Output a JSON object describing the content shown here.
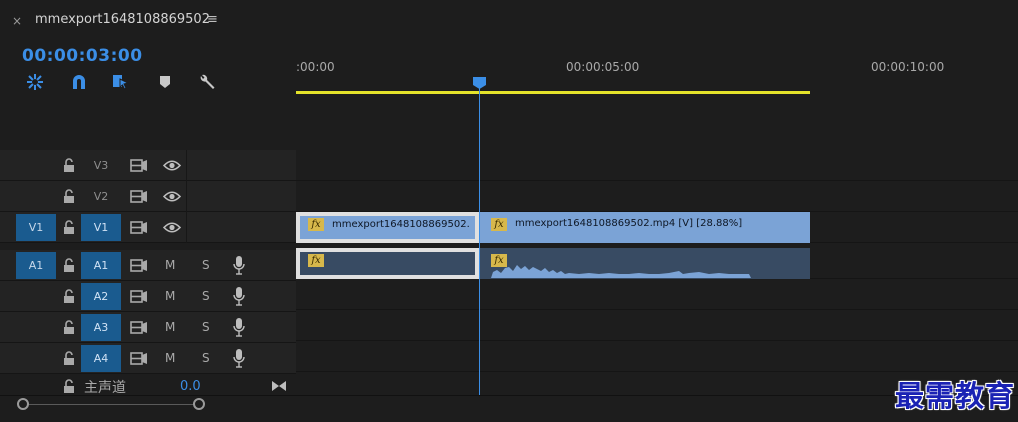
{
  "panel": {
    "close_glyph": "×",
    "sequence_title": "mmexport1648108869502",
    "menu_glyph": "≡",
    "timecode": "00:00:03:00"
  },
  "toolbar": {
    "icons": [
      "nest-sequence-icon",
      "snap-magnet-icon",
      "linked-selection-icon",
      "add-marker-icon",
      "timeline-settings-wrench-icon"
    ]
  },
  "ruler": {
    "labels": [
      ":00:00",
      "00:00:05:00",
      "00:00:10:00"
    ]
  },
  "tracks": {
    "video": [
      {
        "source": "",
        "name": "V3",
        "targeted": false
      },
      {
        "source": "",
        "name": "V2",
        "targeted": false
      },
      {
        "source": "V1",
        "name": "V1",
        "targeted": true
      }
    ],
    "audio": [
      {
        "source": "A1",
        "name": "A1",
        "targeted": true,
        "mute": "M",
        "solo": "S"
      },
      {
        "source": "",
        "name": "A2",
        "targeted": true,
        "mute": "M",
        "solo": "S"
      },
      {
        "source": "",
        "name": "A3",
        "targeted": true,
        "mute": "M",
        "solo": "S"
      },
      {
        "source": "",
        "name": "A4",
        "targeted": true,
        "mute": "M",
        "solo": "S"
      }
    ],
    "master": {
      "label": "主声道",
      "value": "0.0"
    }
  },
  "clips": {
    "fx_label": "fx",
    "video_clip_1": "mmexport1648108869502.",
    "video_clip_2": "mmexport1648108869502.mp4 [V] [28.88%]"
  },
  "watermark": "最需教育",
  "colors": {
    "accent_blue": "#3b8ee6",
    "work_area_yellow": "#e4e22a",
    "video_clip": "#7ba3d6",
    "audio_clip": "#384b63",
    "fx_badge": "#d7b84b",
    "track_target": "#1a5b8f"
  }
}
